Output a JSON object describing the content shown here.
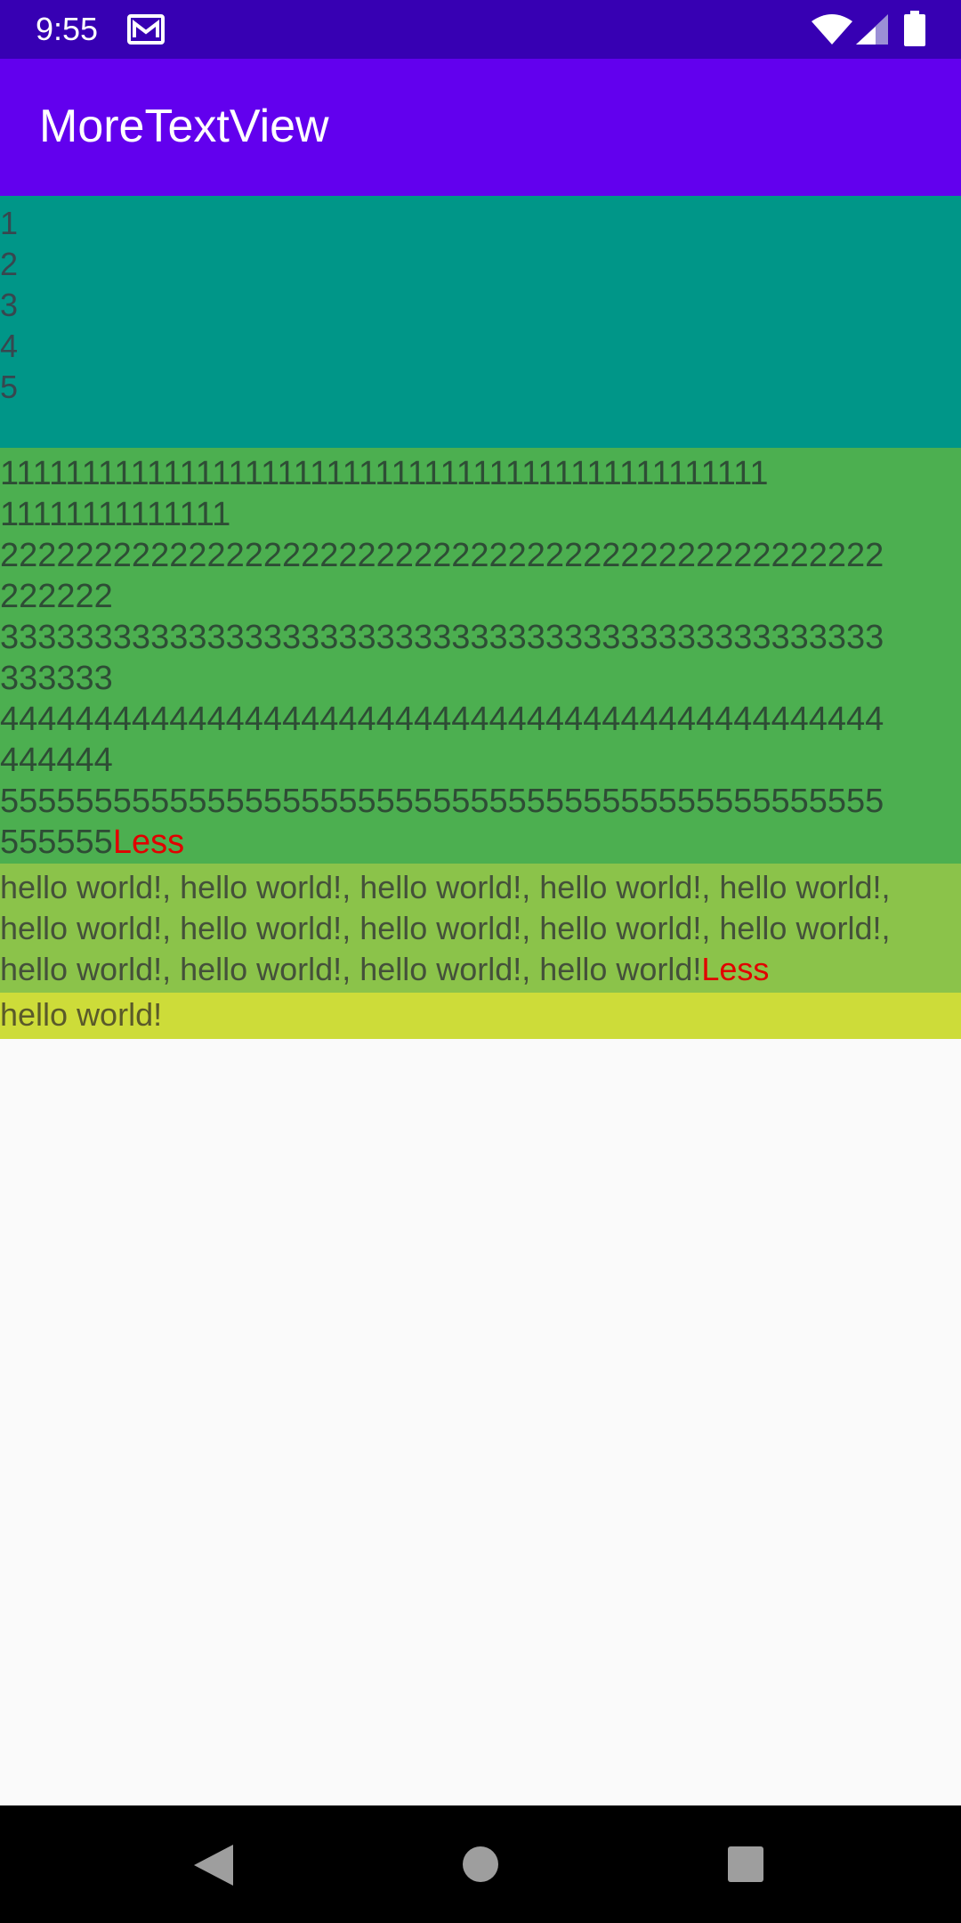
{
  "status_bar": {
    "time": "9:55",
    "icons": [
      "mail-icon",
      "wifi-icon",
      "signal-icon",
      "battery-icon"
    ],
    "background": "#3700b3"
  },
  "app_bar": {
    "title": "MoreTextView",
    "background": "#6200ee"
  },
  "blocks": {
    "lines": {
      "background": "#009688",
      "items": [
        "1",
        "2",
        "3",
        "4",
        "5"
      ]
    },
    "numbers": {
      "background": "#4caf50",
      "lines": [
        "11111111111111111111111111111111111111111111111",
        "11111111111111",
        "22222222222222222222222222222222222222222222222",
        "222222",
        "33333333333333333333333333333333333333333333333",
        "333333",
        "44444444444444444444444444444444444444444444444",
        "444444",
        "55555555555555555555555555555555555555555555555",
        "555555"
      ],
      "less_label": "Less"
    },
    "hello": {
      "background": "#8bc34a",
      "lines": [
        "hello world!, hello world!, hello world!, hello world!, hello world!,",
        "hello world!, hello world!, hello world!, hello world!, hello world!,",
        "hello world!, hello world!, hello world!, hello world!"
      ],
      "less_label": "Less"
    },
    "single": {
      "background": "#cddc39",
      "text": "hello world!"
    }
  },
  "nav_bar": {
    "icons": [
      "back-icon",
      "home-icon",
      "recent-apps-icon"
    ]
  },
  "colors": {
    "less_link": "#e10000",
    "page_background": "#fafafa"
  }
}
